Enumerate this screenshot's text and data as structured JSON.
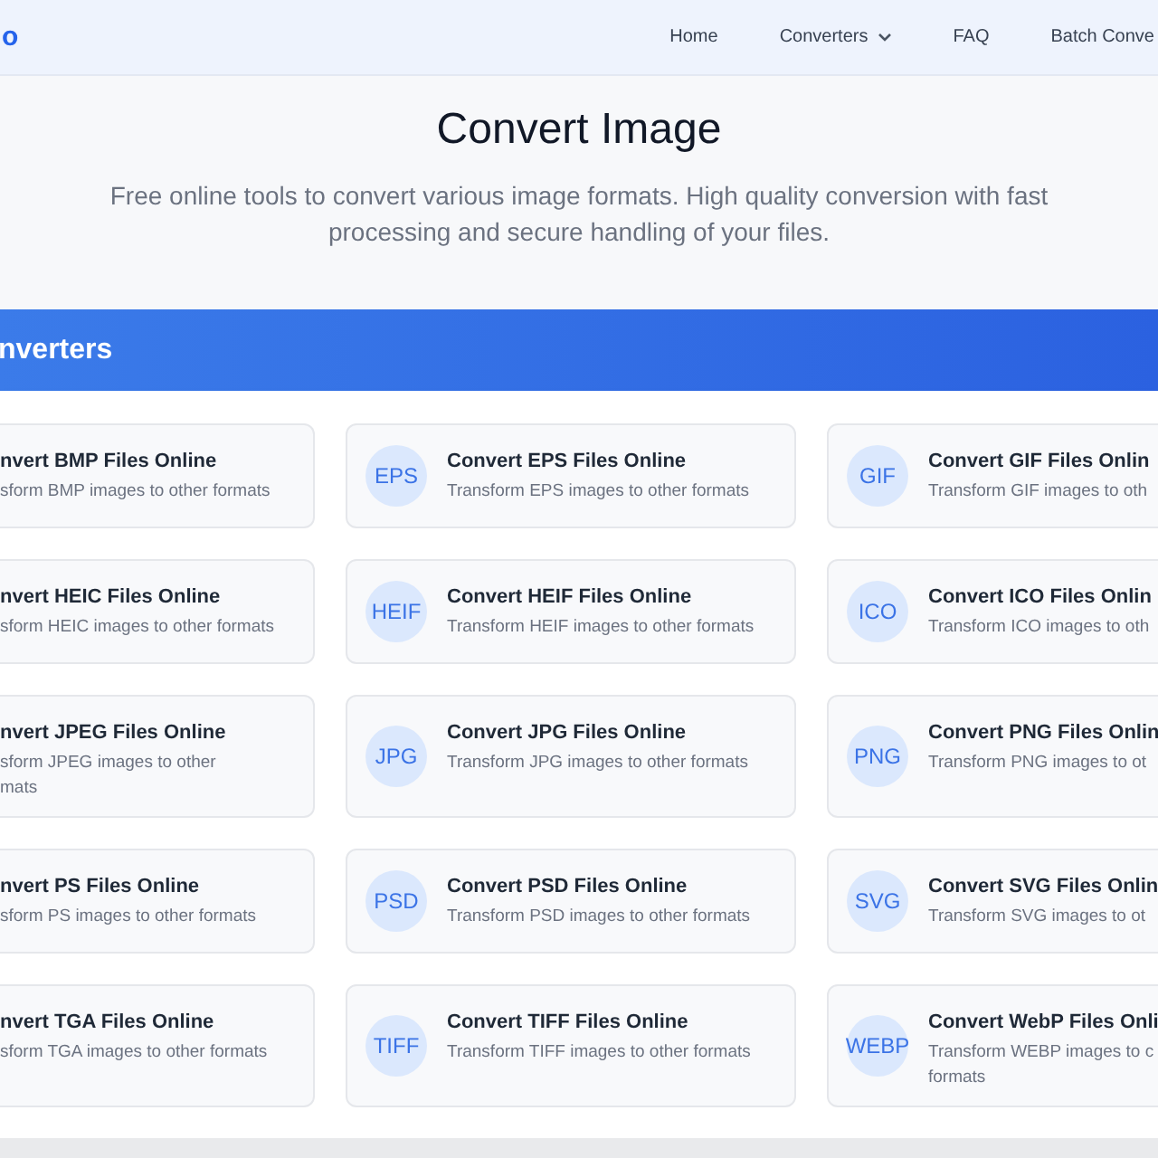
{
  "header": {
    "logo": "o",
    "nav": [
      {
        "label": "Home",
        "dropdown": false
      },
      {
        "label": "Converters",
        "dropdown": true
      },
      {
        "label": "FAQ",
        "dropdown": false
      },
      {
        "label": "Batch Conve",
        "dropdown": false
      }
    ]
  },
  "hero": {
    "title": "Convert Image",
    "subtitle": "Free online tools to convert various image formats. High quality conversion with fast processing and secure handling of your files."
  },
  "section": {
    "title": "nverters",
    "cards": [
      {
        "title": "nvert BMP Files Online",
        "description": "sform BMP images to other formats"
      },
      {
        "badge": "EPS",
        "title": "Convert EPS Files Online",
        "description": "Transform EPS images to other formats"
      },
      {
        "badge": "GIF",
        "title": "Convert GIF Files Onlin",
        "description": "Transform GIF images to oth"
      },
      {
        "title": "nvert HEIC Files Online",
        "description": "sform HEIC images to other formats"
      },
      {
        "badge": "HEIF",
        "title": "Convert HEIF Files Online",
        "description": "Transform HEIF images to other formats"
      },
      {
        "badge": "ICO",
        "title": "Convert ICO Files Onlin",
        "description": "Transform ICO images to oth"
      },
      {
        "title": "nvert JPEG Files Online",
        "description": "sform JPEG images to other\nmats"
      },
      {
        "badge": "JPG",
        "title": "Convert JPG Files Online",
        "description": "Transform JPG images to other formats"
      },
      {
        "badge": "PNG",
        "title": "Convert PNG Files Onlin",
        "description": "Transform PNG images to ot"
      },
      {
        "title": "nvert PS Files Online",
        "description": "sform PS images to other formats"
      },
      {
        "badge": "PSD",
        "title": "Convert PSD Files Online",
        "description": "Transform PSD images to other formats"
      },
      {
        "badge": "SVG",
        "title": "Convert SVG Files Onlin",
        "description": "Transform SVG images to ot"
      },
      {
        "title": "nvert TGA Files Online",
        "description": "sform TGA images to other formats"
      },
      {
        "badge": "TIFF",
        "title": "Convert TIFF Files Online",
        "description": "Transform TIFF images to other formats"
      },
      {
        "badge": "WEBP",
        "title": "Convert WebP Files Onli",
        "description": "Transform WEBP images to c\nformats"
      }
    ]
  }
}
